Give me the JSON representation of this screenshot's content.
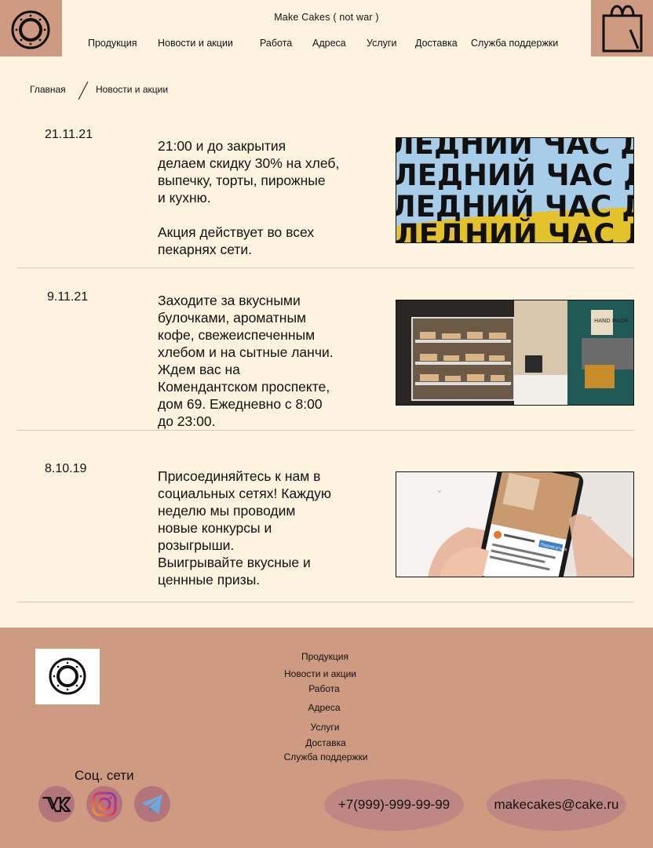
{
  "header": {
    "site_title": "Make Cakes ( not war )",
    "nav": [
      "Продукция",
      "Новости и акции",
      "Работа",
      "Адреса",
      "Услуги",
      "Доставка",
      "Служба поддержки"
    ]
  },
  "breadcrumb": {
    "home": "Главная",
    "current": "Новости и акции"
  },
  "news": [
    {
      "date": "21.11.21",
      "text": " 21:00 и до закрытия\nделаем скидку 30% на хлеб,\nвыпечку, торты, пирожные\nи кухню.\n\nАкция действует во всех\nпекарнях сети.",
      "image_text": "ЛЕДНИЙ ЧАС ДО"
    },
    {
      "date": "9.11.21",
      "text": "Заходите за вкусными\nбулочками, ароматным\nкофе, свежеиспеченным\nхлебом и на сытные ланчи.\nЖдем вас на\nКомендантском проспекте,\nдом 69. Ежедневно с 8:00\nдо 23:00.",
      "image_text": "HAND MADE"
    },
    {
      "date": "8.10.19",
      "text": "Присоединяйтесь к нам в\nсоциальных сетях! Каждую\nнеделю мы проводим\nновые конкурсы и\nрозыгрыши.\nВыигрывайте вкусные и\nценнные призы.",
      "image_text": "Подписаться"
    }
  ],
  "footer": {
    "links": [
      "Продукция",
      "Новости и акции",
      "Работа",
      "Адреса",
      "Услуги",
      "Доставка",
      "Служба поддержки"
    ],
    "social_title": "Соц. сети",
    "social": [
      "vk-icon",
      "instagram-icon",
      "telegram-icon"
    ],
    "phone": "+7(999)-999-99-99",
    "email": "makecakes@cake.ru"
  },
  "colors": {
    "background": "#fdf3df",
    "accent": "#cf9a82",
    "pill": "#bf8783",
    "social_circle": "#b3757a"
  }
}
